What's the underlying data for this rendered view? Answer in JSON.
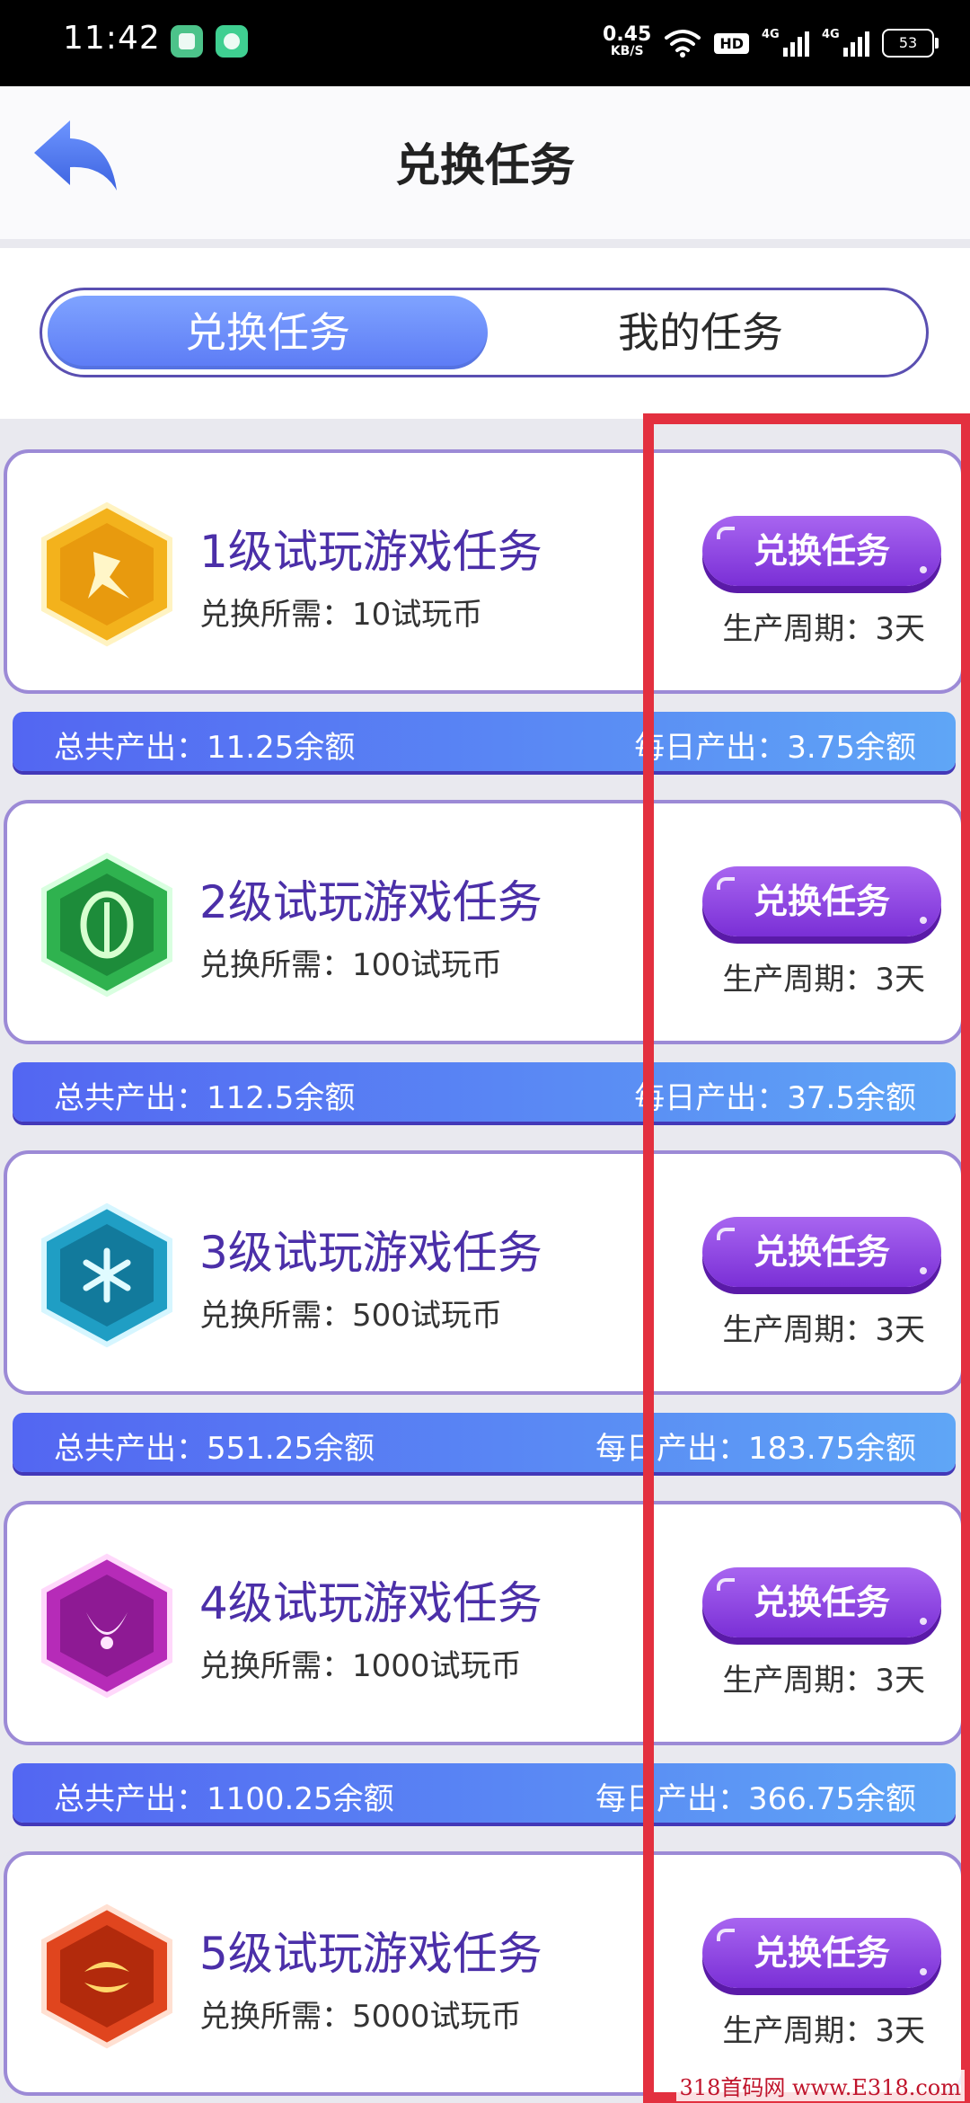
{
  "status_bar": {
    "time": "11:42",
    "speed_value": "0.45",
    "speed_unit": "KB/S",
    "hd_label": "HD",
    "signal1_label": "4G",
    "signal2_label": "4G",
    "battery": "53"
  },
  "header": {
    "title": "兑换任务"
  },
  "tabs": [
    {
      "label": "兑换任务",
      "active": true
    },
    {
      "label": "我的任务",
      "active": false
    }
  ],
  "tasks": [
    {
      "title": "1级试玩游戏任务",
      "cost": "兑换所需：10试玩币",
      "button": "兑换任务",
      "period": "生产周期：3天",
      "total": "总共产出：11.25余额",
      "daily": "每日产出：3.75余额",
      "gem_color": "#f3b21c"
    },
    {
      "title": "2级试玩游戏任务",
      "cost": "兑换所需：100试玩币",
      "button": "兑换任务",
      "period": "生产周期：3天",
      "total": "总共产出：112.5余额",
      "daily": "每日产出：37.5余额",
      "gem_color": "#2fb24f"
    },
    {
      "title": "3级试玩游戏任务",
      "cost": "兑换所需：500试玩币",
      "button": "兑换任务",
      "period": "生产周期：3天",
      "total": "总共产出：551.25余额",
      "daily": "每日产出：183.75余额",
      "gem_color": "#1f9ec4"
    },
    {
      "title": "4级试玩游戏任务",
      "cost": "兑换所需：1000试玩币",
      "button": "兑换任务",
      "period": "生产周期：3天",
      "total": "总共产出：1100.25余额",
      "daily": "每日产出：366.75余额",
      "gem_color": "#b62bb8"
    },
    {
      "title": "5级试玩游戏任务",
      "cost": "兑换所需：5000试玩币",
      "button": "兑换任务",
      "period": "生产周期：3天",
      "total": "",
      "daily": "",
      "gem_color": "#e0451e"
    }
  ],
  "watermark": "318首码网 www.E318.com",
  "colors": {
    "accent_purple": "#7a2fd6",
    "tab_blue": "#5c7bf5",
    "highlight_red": "#e3303f"
  }
}
